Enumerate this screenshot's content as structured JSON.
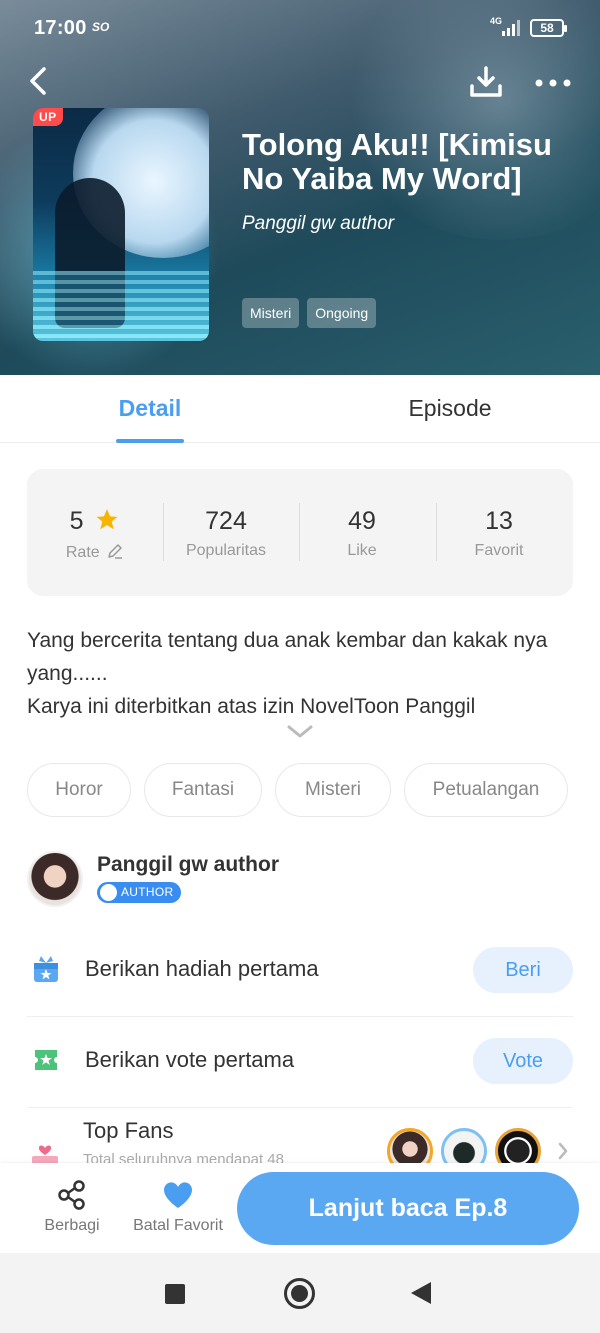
{
  "status_bar": {
    "time": "17:00",
    "carrier_tag": "SO",
    "network": "4G",
    "battery": "58"
  },
  "book": {
    "up_badge": "UP",
    "title": "Tolong Aku!! [Kimisu No Yaiba My Word]",
    "author": "Panggil gw author",
    "genres": [
      "Misteri",
      "Ongoing"
    ]
  },
  "tabs": {
    "detail": "Detail",
    "episode": "Episode"
  },
  "stats": [
    {
      "value": "5",
      "label": "Rate"
    },
    {
      "value": "724",
      "label": "Popularitas"
    },
    {
      "value": "49",
      "label": "Like"
    },
    {
      "value": "13",
      "label": "Favorit"
    }
  ],
  "description": {
    "line1": "Yang bercerita tentang dua anak kembar dan kakak nya yang......",
    "line2": "Karya ini diterbitkan atas izin NovelToon Panggil"
  },
  "tags": [
    "Horor",
    "Fantasi",
    "Misteri",
    "Petualangan"
  ],
  "author": {
    "name": "Panggil gw author",
    "badge": "AUTHOR"
  },
  "actions": {
    "gift": {
      "text": "Berikan hadiah pertama",
      "button": "Beri"
    },
    "vote": {
      "text": "Berikan vote pertama",
      "button": "Vote"
    }
  },
  "top_fans": {
    "title": "Top Fans",
    "subtitle": "Total seluruhnya mendapat 48"
  },
  "bottom_bar": {
    "share": "Berbagi",
    "unfavorite": "Batal Favorit",
    "continue": "Lanjut baca Ep.8"
  },
  "colors": {
    "accent": "#4a9ef0",
    "star": "#f7b500",
    "badge_red": "#ff4b4b"
  }
}
